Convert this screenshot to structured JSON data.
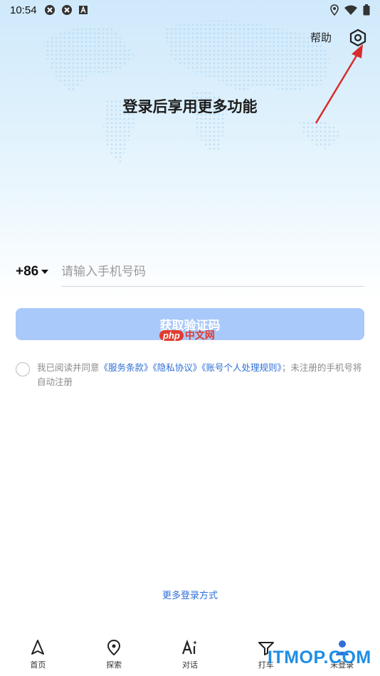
{
  "status_bar": {
    "time": "10:54"
  },
  "header": {
    "help_label": "帮助",
    "settings_icon": "settings-hexagon-icon"
  },
  "headline": "登录后享用更多功能",
  "phone": {
    "country_code": "+86",
    "placeholder": "请输入手机号码",
    "value": ""
  },
  "otp_button_label": "获取验证码",
  "watermark": {
    "php": "php",
    "cn": "中文网"
  },
  "agreement": {
    "checked": false,
    "prefix": "我已阅读并同意",
    "link_terms": "《服务条款》",
    "link_privacy": "《隐私协议》",
    "link_rules": "《账号个人处理规则》",
    "suffix": "；未注册的手机号将自动注册"
  },
  "more_login": "更多登录方式",
  "bottom_nav": [
    {
      "label": "首页",
      "icon": "navigation-arrow-icon"
    },
    {
      "label": "探索",
      "icon": "location-pin-icon"
    },
    {
      "label": "对话",
      "icon": "ai-chat-icon"
    },
    {
      "label": "打车",
      "icon": "taxi-icon"
    },
    {
      "label": "未登录",
      "icon": "user-icon"
    }
  ],
  "site_watermark": "ITMOP.COM",
  "colors": {
    "accent_blue": "#2f6fd6",
    "button_disabled": "#a9c9fb",
    "annotation_arrow": "#d92b2b"
  }
}
